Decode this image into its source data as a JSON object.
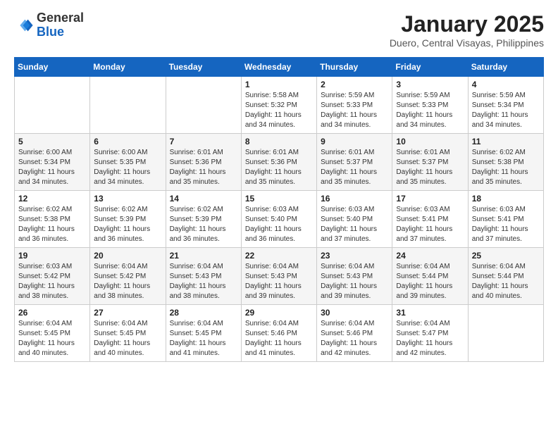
{
  "logo": {
    "general": "General",
    "blue": "Blue"
  },
  "title": "January 2025",
  "subtitle": "Duero, Central Visayas, Philippines",
  "days": [
    "Sunday",
    "Monday",
    "Tuesday",
    "Wednesday",
    "Thursday",
    "Friday",
    "Saturday"
  ],
  "weeks": [
    [
      {
        "day": "",
        "info": ""
      },
      {
        "day": "",
        "info": ""
      },
      {
        "day": "",
        "info": ""
      },
      {
        "day": "1",
        "info": "Sunrise: 5:58 AM\nSunset: 5:32 PM\nDaylight: 11 hours\nand 34 minutes."
      },
      {
        "day": "2",
        "info": "Sunrise: 5:59 AM\nSunset: 5:33 PM\nDaylight: 11 hours\nand 34 minutes."
      },
      {
        "day": "3",
        "info": "Sunrise: 5:59 AM\nSunset: 5:33 PM\nDaylight: 11 hours\nand 34 minutes."
      },
      {
        "day": "4",
        "info": "Sunrise: 5:59 AM\nSunset: 5:34 PM\nDaylight: 11 hours\nand 34 minutes."
      }
    ],
    [
      {
        "day": "5",
        "info": "Sunrise: 6:00 AM\nSunset: 5:34 PM\nDaylight: 11 hours\nand 34 minutes."
      },
      {
        "day": "6",
        "info": "Sunrise: 6:00 AM\nSunset: 5:35 PM\nDaylight: 11 hours\nand 34 minutes."
      },
      {
        "day": "7",
        "info": "Sunrise: 6:01 AM\nSunset: 5:36 PM\nDaylight: 11 hours\nand 35 minutes."
      },
      {
        "day": "8",
        "info": "Sunrise: 6:01 AM\nSunset: 5:36 PM\nDaylight: 11 hours\nand 35 minutes."
      },
      {
        "day": "9",
        "info": "Sunrise: 6:01 AM\nSunset: 5:37 PM\nDaylight: 11 hours\nand 35 minutes."
      },
      {
        "day": "10",
        "info": "Sunrise: 6:01 AM\nSunset: 5:37 PM\nDaylight: 11 hours\nand 35 minutes."
      },
      {
        "day": "11",
        "info": "Sunrise: 6:02 AM\nSunset: 5:38 PM\nDaylight: 11 hours\nand 35 minutes."
      }
    ],
    [
      {
        "day": "12",
        "info": "Sunrise: 6:02 AM\nSunset: 5:38 PM\nDaylight: 11 hours\nand 36 minutes."
      },
      {
        "day": "13",
        "info": "Sunrise: 6:02 AM\nSunset: 5:39 PM\nDaylight: 11 hours\nand 36 minutes."
      },
      {
        "day": "14",
        "info": "Sunrise: 6:02 AM\nSunset: 5:39 PM\nDaylight: 11 hours\nand 36 minutes."
      },
      {
        "day": "15",
        "info": "Sunrise: 6:03 AM\nSunset: 5:40 PM\nDaylight: 11 hours\nand 36 minutes."
      },
      {
        "day": "16",
        "info": "Sunrise: 6:03 AM\nSunset: 5:40 PM\nDaylight: 11 hours\nand 37 minutes."
      },
      {
        "day": "17",
        "info": "Sunrise: 6:03 AM\nSunset: 5:41 PM\nDaylight: 11 hours\nand 37 minutes."
      },
      {
        "day": "18",
        "info": "Sunrise: 6:03 AM\nSunset: 5:41 PM\nDaylight: 11 hours\nand 37 minutes."
      }
    ],
    [
      {
        "day": "19",
        "info": "Sunrise: 6:03 AM\nSunset: 5:42 PM\nDaylight: 11 hours\nand 38 minutes."
      },
      {
        "day": "20",
        "info": "Sunrise: 6:04 AM\nSunset: 5:42 PM\nDaylight: 11 hours\nand 38 minutes."
      },
      {
        "day": "21",
        "info": "Sunrise: 6:04 AM\nSunset: 5:43 PM\nDaylight: 11 hours\nand 38 minutes."
      },
      {
        "day": "22",
        "info": "Sunrise: 6:04 AM\nSunset: 5:43 PM\nDaylight: 11 hours\nand 39 minutes."
      },
      {
        "day": "23",
        "info": "Sunrise: 6:04 AM\nSunset: 5:43 PM\nDaylight: 11 hours\nand 39 minutes."
      },
      {
        "day": "24",
        "info": "Sunrise: 6:04 AM\nSunset: 5:44 PM\nDaylight: 11 hours\nand 39 minutes."
      },
      {
        "day": "25",
        "info": "Sunrise: 6:04 AM\nSunset: 5:44 PM\nDaylight: 11 hours\nand 40 minutes."
      }
    ],
    [
      {
        "day": "26",
        "info": "Sunrise: 6:04 AM\nSunset: 5:45 PM\nDaylight: 11 hours\nand 40 minutes."
      },
      {
        "day": "27",
        "info": "Sunrise: 6:04 AM\nSunset: 5:45 PM\nDaylight: 11 hours\nand 40 minutes."
      },
      {
        "day": "28",
        "info": "Sunrise: 6:04 AM\nSunset: 5:45 PM\nDaylight: 11 hours\nand 41 minutes."
      },
      {
        "day": "29",
        "info": "Sunrise: 6:04 AM\nSunset: 5:46 PM\nDaylight: 11 hours\nand 41 minutes."
      },
      {
        "day": "30",
        "info": "Sunrise: 6:04 AM\nSunset: 5:46 PM\nDaylight: 11 hours\nand 42 minutes."
      },
      {
        "day": "31",
        "info": "Sunrise: 6:04 AM\nSunset: 5:47 PM\nDaylight: 11 hours\nand 42 minutes."
      },
      {
        "day": "",
        "info": ""
      }
    ]
  ]
}
